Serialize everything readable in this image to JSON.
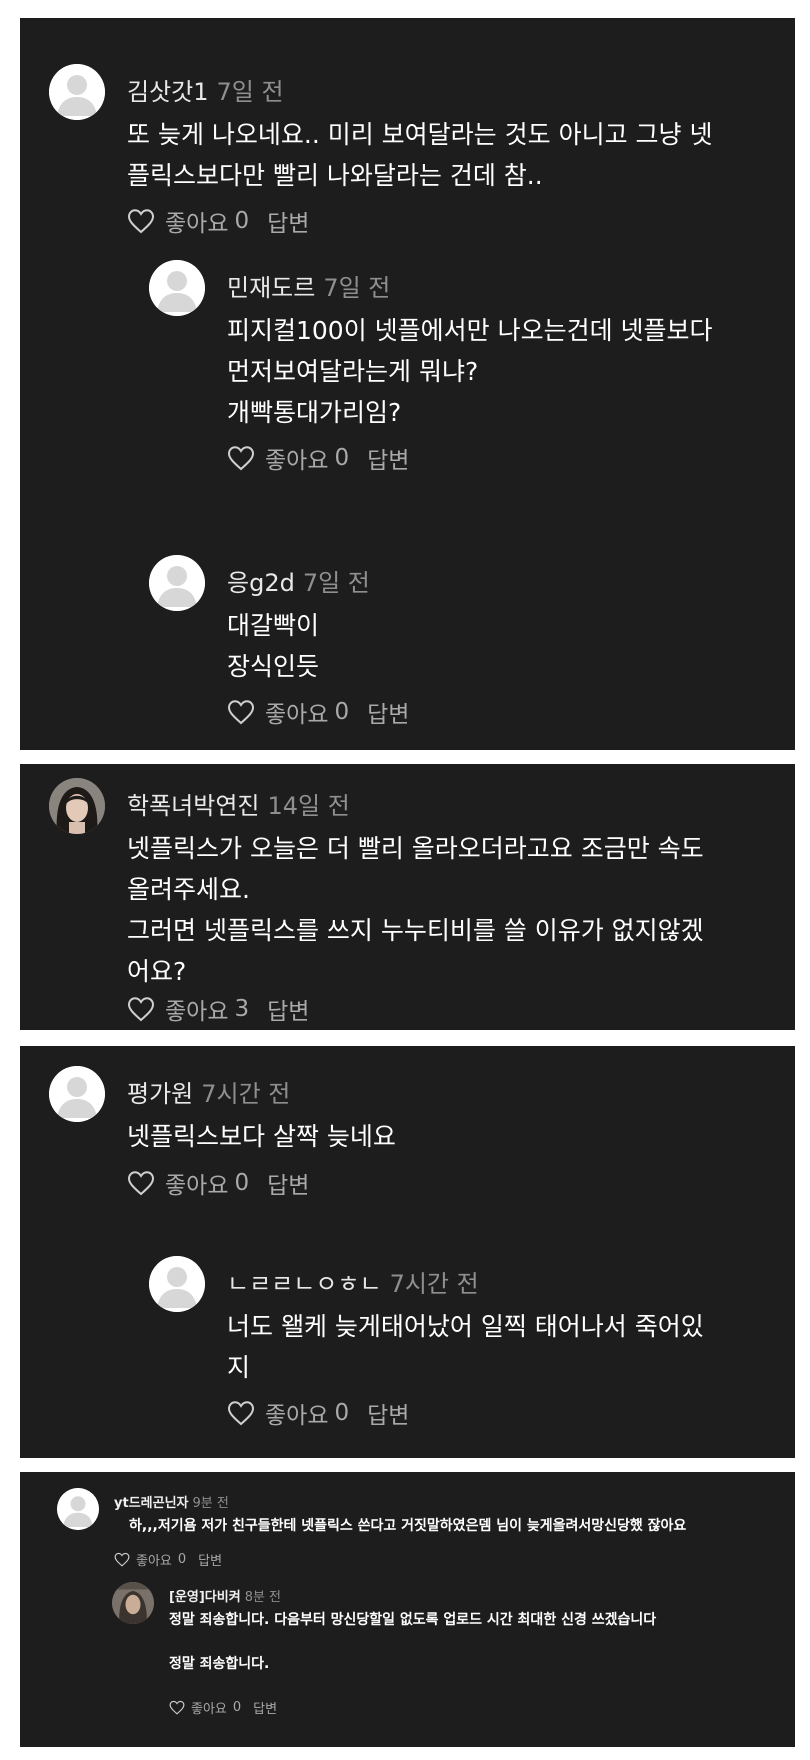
{
  "like_label": "좋아요",
  "reply_label": "답변",
  "icons": {
    "avatar": "default-user-avatar",
    "like": "heart-outline-icon"
  },
  "colors": {
    "panel_bg": "#1d1d1d",
    "text": "#ffffff",
    "meta": "#8f8f8f",
    "separator": "#ffffff"
  },
  "threads": [
    {
      "comments": [
        {
          "author": "김삿갓1",
          "time": "7일 전",
          "lines": [
            "또 늦게 나오네요.. 미리 보여달라는 것도 아니고 그냥 넷",
            "플릭스보다만 빨리 나와달라는 건데 참.."
          ],
          "likes": "0"
        },
        {
          "author": "민재도르",
          "time": "7일 전",
          "lines": [
            "피지컬100이 넷플에서만 나오는건데 넷플보다",
            "먼저보여달라는게 뭐냐?",
            "개빡통대가리임?"
          ],
          "likes": "0"
        },
        {
          "author": "응g2d",
          "time": "7일 전",
          "lines": [
            "대갈빡이",
            "장식인듯"
          ],
          "likes": "0"
        }
      ]
    },
    {
      "comments": [
        {
          "author": "학폭녀박연진",
          "time": "14일 전",
          "lines": [
            "넷플릭스가 오늘은 더 빨리 올라오더라고요 조금만 속도",
            "올려주세요.",
            "그러면 넷플릭스를 쓰지 누누티비를 쓸 이유가 없지않겠",
            "어요?"
          ],
          "likes": "3"
        }
      ]
    },
    {
      "comments": [
        {
          "author": "평가원",
          "time": "7시간 전",
          "lines": [
            "넷플릭스보다 살짝 늦네요"
          ],
          "likes": "0"
        },
        {
          "author": "ㄴㄹㄹㄴㅇㅎㄴ",
          "time": "7시간 전",
          "lines": [
            "너도 왤케 늦게태어났어 일찍 태어나서 죽어있",
            "지"
          ],
          "likes": "0"
        }
      ]
    },
    {
      "comments": [
        {
          "author": "yt드레곤닌자",
          "time": "9분 전",
          "lines": [
            "하,,,저기욤 저가 친구들한테 넷플릭스 쓴다고 거짓말하였은뎀 님이 늦게올려서망신당했 잖아요"
          ],
          "likes": "0"
        },
        {
          "author": "[운영]다비켜",
          "time": "8분 전",
          "lines": [
            "정말 죄송합니다. 다음부터 망신당할일 없도록 업로드 시간 최대한 신경 쓰겠습니다",
            "",
            "정말 죄송합니다."
          ],
          "likes": "0"
        }
      ]
    }
  ]
}
